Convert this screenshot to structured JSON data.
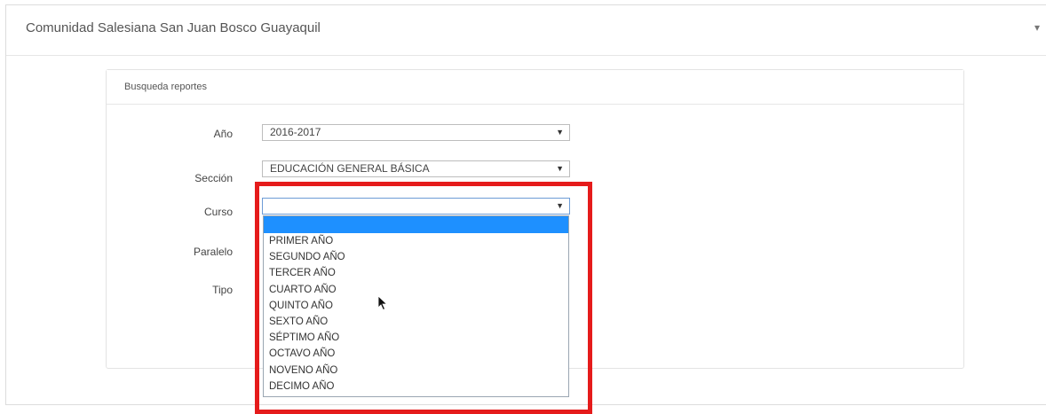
{
  "header": {
    "title": "Comunidad Salesiana San Juan Bosco Guayaquil",
    "menu_caret": "▾"
  },
  "panel": {
    "heading": "Busqueda reportes"
  },
  "form": {
    "anio": {
      "label": "Año",
      "value": "2016-2017"
    },
    "seccion": {
      "label": "Sección",
      "value": "EDUCACIÓN GENERAL BÁSICA"
    },
    "curso": {
      "label": "Curso",
      "value": ""
    },
    "paralelo": {
      "label": "Paralelo"
    },
    "tipo": {
      "label": "Tipo"
    },
    "caret": "▼"
  },
  "curso_options": [
    "",
    "PRIMER AÑO",
    "SEGUNDO AÑO",
    "TERCER AÑO",
    "CUARTO AÑO",
    "QUINTO AÑO",
    "SEXTO AÑO",
    "SÉPTIMO AÑO",
    "OCTAVO AÑO",
    "NOVENO AÑO",
    "DECIMO AÑO"
  ],
  "colors": {
    "highlight": "#1e90ff",
    "annotation_box": "#e51b1b"
  }
}
